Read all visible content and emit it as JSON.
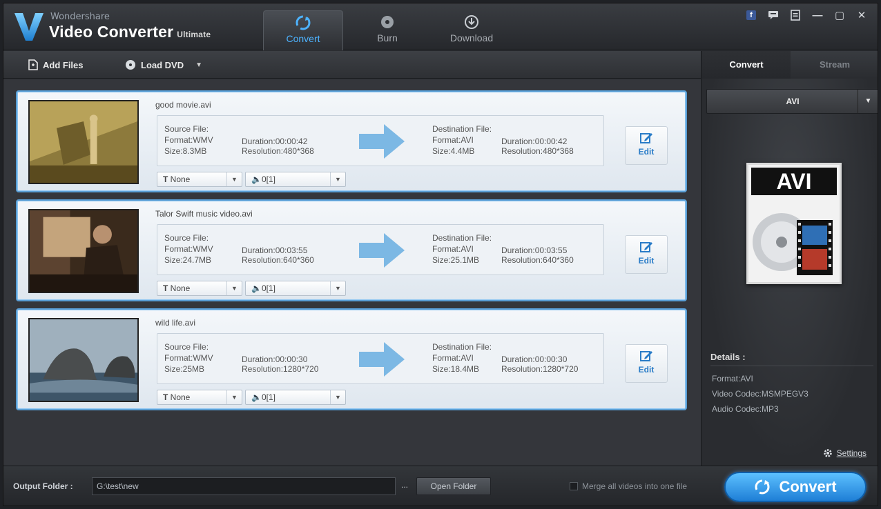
{
  "app": {
    "brand_small": "Wondershare",
    "brand_main": "Video Converter",
    "brand_edition": "Ultimate"
  },
  "nav_tabs": [
    {
      "label": "Convert",
      "icon": "convert-icon",
      "active": true
    },
    {
      "label": "Burn",
      "icon": "burn-disc-icon",
      "active": false
    },
    {
      "label": "Download",
      "icon": "download-icon",
      "active": false
    }
  ],
  "window_controls": [
    "facebook-icon",
    "chat-icon",
    "notes-icon",
    "minimize-icon",
    "maximize-icon",
    "close-icon"
  ],
  "toolbar": {
    "add_files": "Add Files",
    "load_dvd": "Load DVD"
  },
  "files": [
    {
      "name": "good movie.avi",
      "source_title": "Source File:",
      "source_format": "Format:WMV",
      "source_size": "Size:8.3MB",
      "source_duration": "Duration:00:00:42",
      "source_resolution": "Resolution:480*368",
      "dest_title": "Destination File:",
      "dest_format": "Format:AVI",
      "dest_size": "Size:4.4MB",
      "dest_duration": "Duration:00:00:42",
      "dest_resolution": "Resolution:480*368",
      "edit_label": "Edit",
      "subtitle": "None",
      "audio": "0[1]"
    },
    {
      "name": "Talor Swift music video.avi",
      "source_title": "Source File:",
      "source_format": "Format:WMV",
      "source_size": "Size:24.7MB",
      "source_duration": "Duration:00:03:55",
      "source_resolution": "Resolution:640*360",
      "dest_title": "Destination File:",
      "dest_format": "Format:AVI",
      "dest_size": "Size:25.1MB",
      "dest_duration": "Duration:00:03:55",
      "dest_resolution": "Resolution:640*360",
      "edit_label": "Edit",
      "subtitle": "None",
      "audio": "0[1]"
    },
    {
      "name": "wild life.avi",
      "source_title": "Source File:",
      "source_format": "Format:WMV",
      "source_size": "Size:25MB",
      "source_duration": "Duration:00:00:30",
      "source_resolution": "Resolution:1280*720",
      "dest_title": "Destination File:",
      "dest_format": "Format:AVI",
      "dest_size": "Size:18.4MB",
      "dest_duration": "Duration:00:00:30",
      "dest_resolution": "Resolution:1280*720",
      "edit_label": "Edit",
      "subtitle": "None",
      "audio": "0[1]"
    }
  ],
  "right_panel": {
    "tabs": [
      {
        "label": "Convert",
        "active": true
      },
      {
        "label": "Stream",
        "active": false
      }
    ],
    "format_selected": "AVI",
    "format_icon_label": "AVI",
    "details_title": "Details :",
    "details": [
      "Format:AVI",
      "Video Codec:MSMPEGV3",
      "Audio Codec:MP3"
    ],
    "settings_label": "Settings"
  },
  "bottom": {
    "output_label": "Output Folder :",
    "output_path": "G:\\test\\new",
    "browse_label": "...",
    "open_folder": "Open Folder",
    "merge_label": "Merge all videos into one file",
    "convert_label": "Convert"
  },
  "colors": {
    "accent": "#2a8fe6",
    "active_tab_text": "#4db3ff",
    "item_border": "#5a9fd6"
  }
}
